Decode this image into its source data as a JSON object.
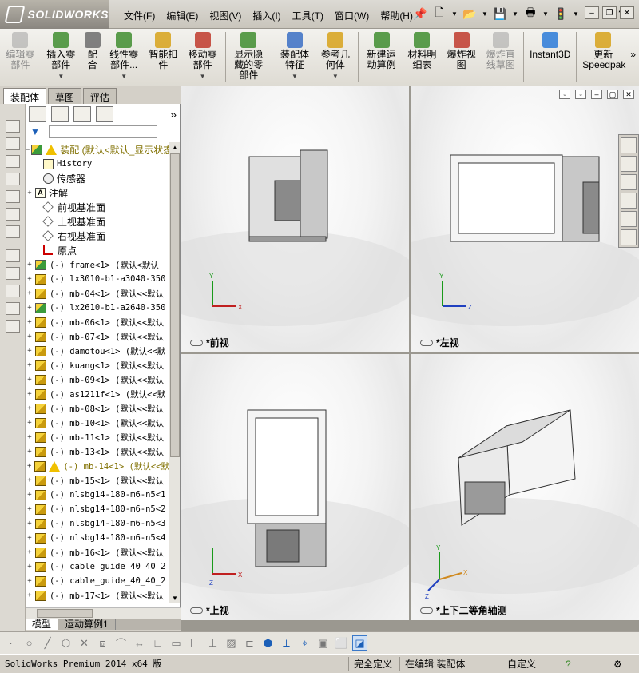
{
  "app": {
    "brand_ds": "DS",
    "brand_name": "SOLIDWORKS"
  },
  "menu": [
    "文件(F)",
    "编辑(E)",
    "视图(V)",
    "插入(I)",
    "工具(T)",
    "窗口(W)",
    "帮助(H)"
  ],
  "quick_access": [
    {
      "icon": "pin-icon",
      "glyph": "📌"
    },
    {
      "icon": "new-document-icon",
      "glyph": "🗋"
    },
    {
      "icon": "open-folder-icon",
      "glyph": "📂"
    },
    {
      "icon": "save-icon",
      "glyph": "💾"
    },
    {
      "icon": "print-icon",
      "glyph": "🖶"
    },
    {
      "icon": "rebuild-icon",
      "glyph": "🚦"
    },
    {
      "icon": "options-gear-icon",
      "glyph": "⚙"
    },
    {
      "icon": "help-icon",
      "glyph": "?"
    }
  ],
  "window_controls": {
    "minimize": "–",
    "restore": "❐",
    "close": "✕"
  },
  "commands": [
    {
      "label": "编辑零部件",
      "disabled": true,
      "caret": false,
      "icon": "edit-component-icon",
      "color": "#9a9a9a"
    },
    {
      "label": "插入零部件",
      "disabled": false,
      "caret": true,
      "icon": "insert-component-icon",
      "color": "#3f8d2f"
    },
    {
      "label": "配合",
      "disabled": false,
      "caret": false,
      "icon": "mate-icon",
      "color": "#6c6c6c"
    },
    {
      "label": "线性零部件...",
      "disabled": false,
      "caret": true,
      "icon": "linear-pattern-icon",
      "color": "#3f8d2f"
    },
    {
      "label": "智能扣件",
      "disabled": false,
      "caret": false,
      "icon": "smart-fastener-icon",
      "color": "#d7a21a"
    },
    {
      "label": "移动零部件",
      "disabled": false,
      "caret": true,
      "icon": "move-component-icon",
      "color": "#c03a2b"
    },
    {
      "label": "显示隐藏的零部件",
      "disabled": false,
      "caret": false,
      "icon": "show-hidden-icon",
      "color": "#3f8d2f"
    },
    {
      "label": "装配体特征",
      "disabled": false,
      "caret": true,
      "icon": "assembly-feature-icon",
      "color": "#3a6fc4"
    },
    {
      "label": "参考几何体",
      "disabled": false,
      "caret": true,
      "icon": "reference-geometry-icon",
      "color": "#d7a21a"
    },
    {
      "label": "新建运动算例",
      "disabled": false,
      "caret": false,
      "icon": "motion-study-icon",
      "color": "#3f8d2f"
    },
    {
      "label": "材料明细表",
      "disabled": false,
      "caret": false,
      "icon": "bom-icon",
      "color": "#3f8d2f"
    },
    {
      "label": "爆炸视图",
      "disabled": false,
      "caret": false,
      "icon": "exploded-view-icon",
      "color": "#c03a2b"
    },
    {
      "label": "爆炸直线草图",
      "disabled": true,
      "caret": false,
      "icon": "explode-line-sketch-icon",
      "color": "#9a9a9a"
    },
    {
      "label": "Instant3D",
      "disabled": false,
      "caret": false,
      "icon": "instant3d-icon",
      "color": "#2a7ad8"
    },
    {
      "label": "更新Speedpak",
      "disabled": false,
      "caret": false,
      "icon": "speedpak-icon",
      "color": "#d7a21a"
    }
  ],
  "command_more": "»",
  "left_tabs": [
    "装配体",
    "草图",
    "评估"
  ],
  "tree": {
    "more": "»",
    "root": "装配   (默认<默认_显示状态",
    "items": [
      {
        "text": "History",
        "type": "history",
        "indent": 1,
        "expand": ""
      },
      {
        "text": "传感器",
        "type": "sensor",
        "indent": 1,
        "expand": "",
        "cn": true
      },
      {
        "text": "注解",
        "type": "annotation",
        "indent": 0,
        "expand": "+",
        "cn": true
      },
      {
        "text": "前视基准面",
        "type": "plane",
        "indent": 1,
        "expand": "",
        "cn": true
      },
      {
        "text": "上视基准面",
        "type": "plane",
        "indent": 1,
        "expand": "",
        "cn": true
      },
      {
        "text": "右视基准面",
        "type": "plane",
        "indent": 1,
        "expand": "",
        "cn": true
      },
      {
        "text": "原点",
        "type": "origin",
        "indent": 1,
        "expand": "",
        "cn": true
      },
      {
        "text": "(-) frame<1> (默认<默认",
        "type": "asm",
        "indent": 0,
        "expand": "+"
      },
      {
        "text": "(-) lx3010-b1-a3040-350",
        "type": "part",
        "indent": 0,
        "expand": "+"
      },
      {
        "text": "(-) mb-04<1> (默认<<默认",
        "type": "part",
        "indent": 0,
        "expand": "+"
      },
      {
        "text": "(-) lx2610-b1-a2640-350",
        "type": "asm",
        "indent": 0,
        "expand": "+"
      },
      {
        "text": "(-) mb-06<1> (默认<<默认",
        "type": "part",
        "indent": 0,
        "expand": "+"
      },
      {
        "text": "(-) mb-07<1> (默认<<默认",
        "type": "part",
        "indent": 0,
        "expand": "+"
      },
      {
        "text": "(-) damotou<1> (默认<<默",
        "type": "part",
        "indent": 0,
        "expand": "+"
      },
      {
        "text": "(-) kuang<1> (默认<<默认",
        "type": "part",
        "indent": 0,
        "expand": "+"
      },
      {
        "text": "(-) mb-09<1> (默认<<默认",
        "type": "part",
        "indent": 0,
        "expand": "+"
      },
      {
        "text": "(-) as1211f<1> (默认<<默",
        "type": "part",
        "indent": 0,
        "expand": "+"
      },
      {
        "text": "(-) mb-08<1> (默认<<默认",
        "type": "part",
        "indent": 0,
        "expand": "+"
      },
      {
        "text": "(-) mb-10<1> (默认<<默认",
        "type": "part",
        "indent": 0,
        "expand": "+"
      },
      {
        "text": "(-) mb-11<1> (默认<<默认",
        "type": "part",
        "indent": 0,
        "expand": "+"
      },
      {
        "text": "(-) mb-13<1> (默认<<默认",
        "type": "part",
        "indent": 0,
        "expand": "+"
      },
      {
        "text": "(-) mb-14<1> (默认<<默",
        "type": "warnpart",
        "indent": 0,
        "expand": "+"
      },
      {
        "text": "(-) mb-15<1> (默认<<默认",
        "type": "part",
        "indent": 0,
        "expand": "+"
      },
      {
        "text": "(-) nlsbg14-180-m6-n5<1",
        "type": "part",
        "indent": 0,
        "expand": "+"
      },
      {
        "text": "(-) nlsbg14-180-m6-n5<2",
        "type": "part",
        "indent": 0,
        "expand": "+"
      },
      {
        "text": "(-) nlsbg14-180-m6-n5<3",
        "type": "part",
        "indent": 0,
        "expand": "+"
      },
      {
        "text": "(-) nlsbg14-180-m6-n5<4",
        "type": "part",
        "indent": 0,
        "expand": "+"
      },
      {
        "text": "(-) mb-16<1> (默认<<默认",
        "type": "part",
        "indent": 0,
        "expand": "+"
      },
      {
        "text": "(-) cable_guide_40_40_2",
        "type": "part",
        "indent": 0,
        "expand": "+"
      },
      {
        "text": "(-) cable_guide_40_40_2",
        "type": "part",
        "indent": 0,
        "expand": "+"
      },
      {
        "text": "(-) mb-17<1> (默认<<默认",
        "type": "part",
        "indent": 0,
        "expand": "+"
      }
    ]
  },
  "model_tabs": [
    "模型",
    "运动算例1"
  ],
  "viewports": [
    {
      "label": "*前视",
      "axes": "x-y"
    },
    {
      "label": "*左视",
      "axes": "z-y"
    },
    {
      "label": "*上视",
      "axes": "x-z"
    },
    {
      "label": "*上下二等角轴测",
      "axes": "iso"
    }
  ],
  "axis_letters": {
    "x": "X",
    "y": "Y",
    "z": "Z"
  },
  "status": {
    "product": "SolidWorks Premium 2014 x64 版",
    "definition": "完全定义",
    "mode": "在编辑 装配体",
    "units": "自定义"
  }
}
